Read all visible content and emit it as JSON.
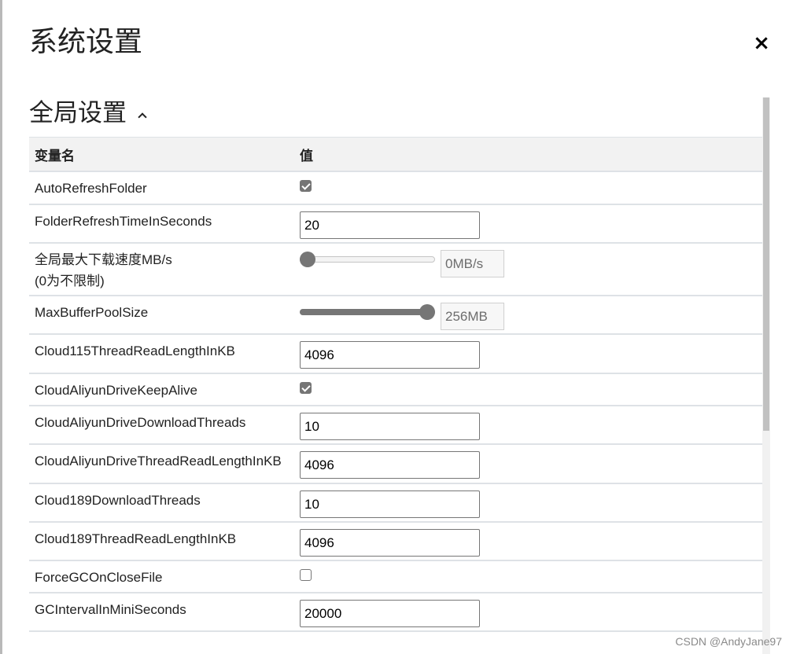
{
  "dialog": {
    "title": "系统设置",
    "close_label": "×"
  },
  "section": {
    "title": "全局设置"
  },
  "table": {
    "headers": {
      "name": "变量名",
      "value": "值"
    },
    "rows": {
      "auto_refresh_folder": {
        "name": "AutoRefreshFolder",
        "checked": true
      },
      "folder_refresh_time": {
        "name": "FolderRefreshTimeInSeconds",
        "value": "20"
      },
      "max_download_speed": {
        "name": "全局最大下载速度MB/s",
        "note": "(0为不限制)",
        "value": 0,
        "readout": "0MB/s",
        "fraction": 0.0
      },
      "max_buffer_pool": {
        "name": "MaxBufferPoolSize",
        "value": 256,
        "readout": "256MB",
        "fraction": 1.0
      },
      "cloud115_read_len": {
        "name": "Cloud115ThreadReadLengthInKB",
        "value": "4096"
      },
      "aliyun_keep_alive": {
        "name": "CloudAliyunDriveKeepAlive",
        "checked": true
      },
      "aliyun_download_threads": {
        "name": "CloudAliyunDriveDownloadThreads",
        "value": "10"
      },
      "aliyun_read_len": {
        "name": "CloudAliyunDriveThreadReadLengthInKB",
        "value": "4096"
      },
      "cloud189_download_threads": {
        "name": "Cloud189DownloadThreads",
        "value": "10"
      },
      "cloud189_read_len": {
        "name": "Cloud189ThreadReadLengthInKB",
        "value": "4096"
      },
      "force_gc": {
        "name": "ForceGCOnCloseFile",
        "checked": false
      },
      "gc_interval": {
        "name": "GCIntervalInMiniSeconds",
        "value": "20000"
      }
    }
  },
  "watermark": "CSDN @AndyJane97"
}
